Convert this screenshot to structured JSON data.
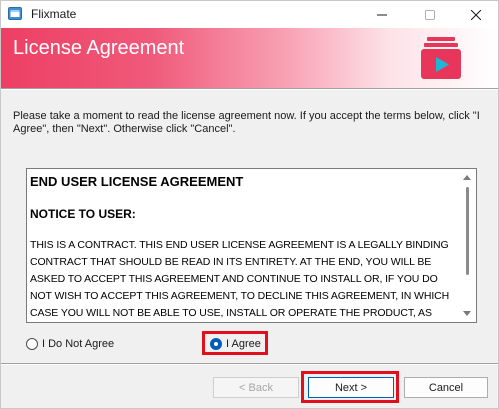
{
  "window": {
    "title": "Flixmate"
  },
  "banner": {
    "title": "License Agreement"
  },
  "instructions": "Please take a moment to read the license agreement now. If you accept the terms below, click \"I Agree\", then \"Next\". Otherwise click \"Cancel\".",
  "license": {
    "heading": "END USER LICENSE AGREEMENT",
    "subheading": "NOTICE TO USER:",
    "body": "THIS IS A CONTRACT. THIS END USER LICENSE AGREEMENT IS A LEGALLY BINDING CONTRACT THAT SHOULD BE READ IN ITS ENTIRETY. AT THE END, YOU WILL BE ASKED TO ACCEPT THIS AGREEMENT AND CONTINUE TO INSTALL OR, IF YOU DO NOT WISH TO ACCEPT THIS AGREEMENT, TO DECLINE THIS AGREEMENT, IN WHICH CASE YOU WILL NOT BE ABLE TO USE, INSTALL OR OPERATE THE PRODUCT, AS"
  },
  "radios": {
    "not_agree_label": "I Do Not Agree",
    "agree_label": "I Agree",
    "selected": "agree"
  },
  "buttons": {
    "back_label": "< Back",
    "next_label": "Next >",
    "cancel_label": "Cancel"
  },
  "colors": {
    "banner_accent": "#ed3f63",
    "highlight": "#e0101e",
    "selection_blue": "#005fb8"
  },
  "icons": {
    "app": "flixmate-app-icon",
    "logo": "flixmate-logo-icon",
    "minimize": "minimize-icon",
    "maximize": "maximize-icon",
    "close": "close-icon"
  }
}
